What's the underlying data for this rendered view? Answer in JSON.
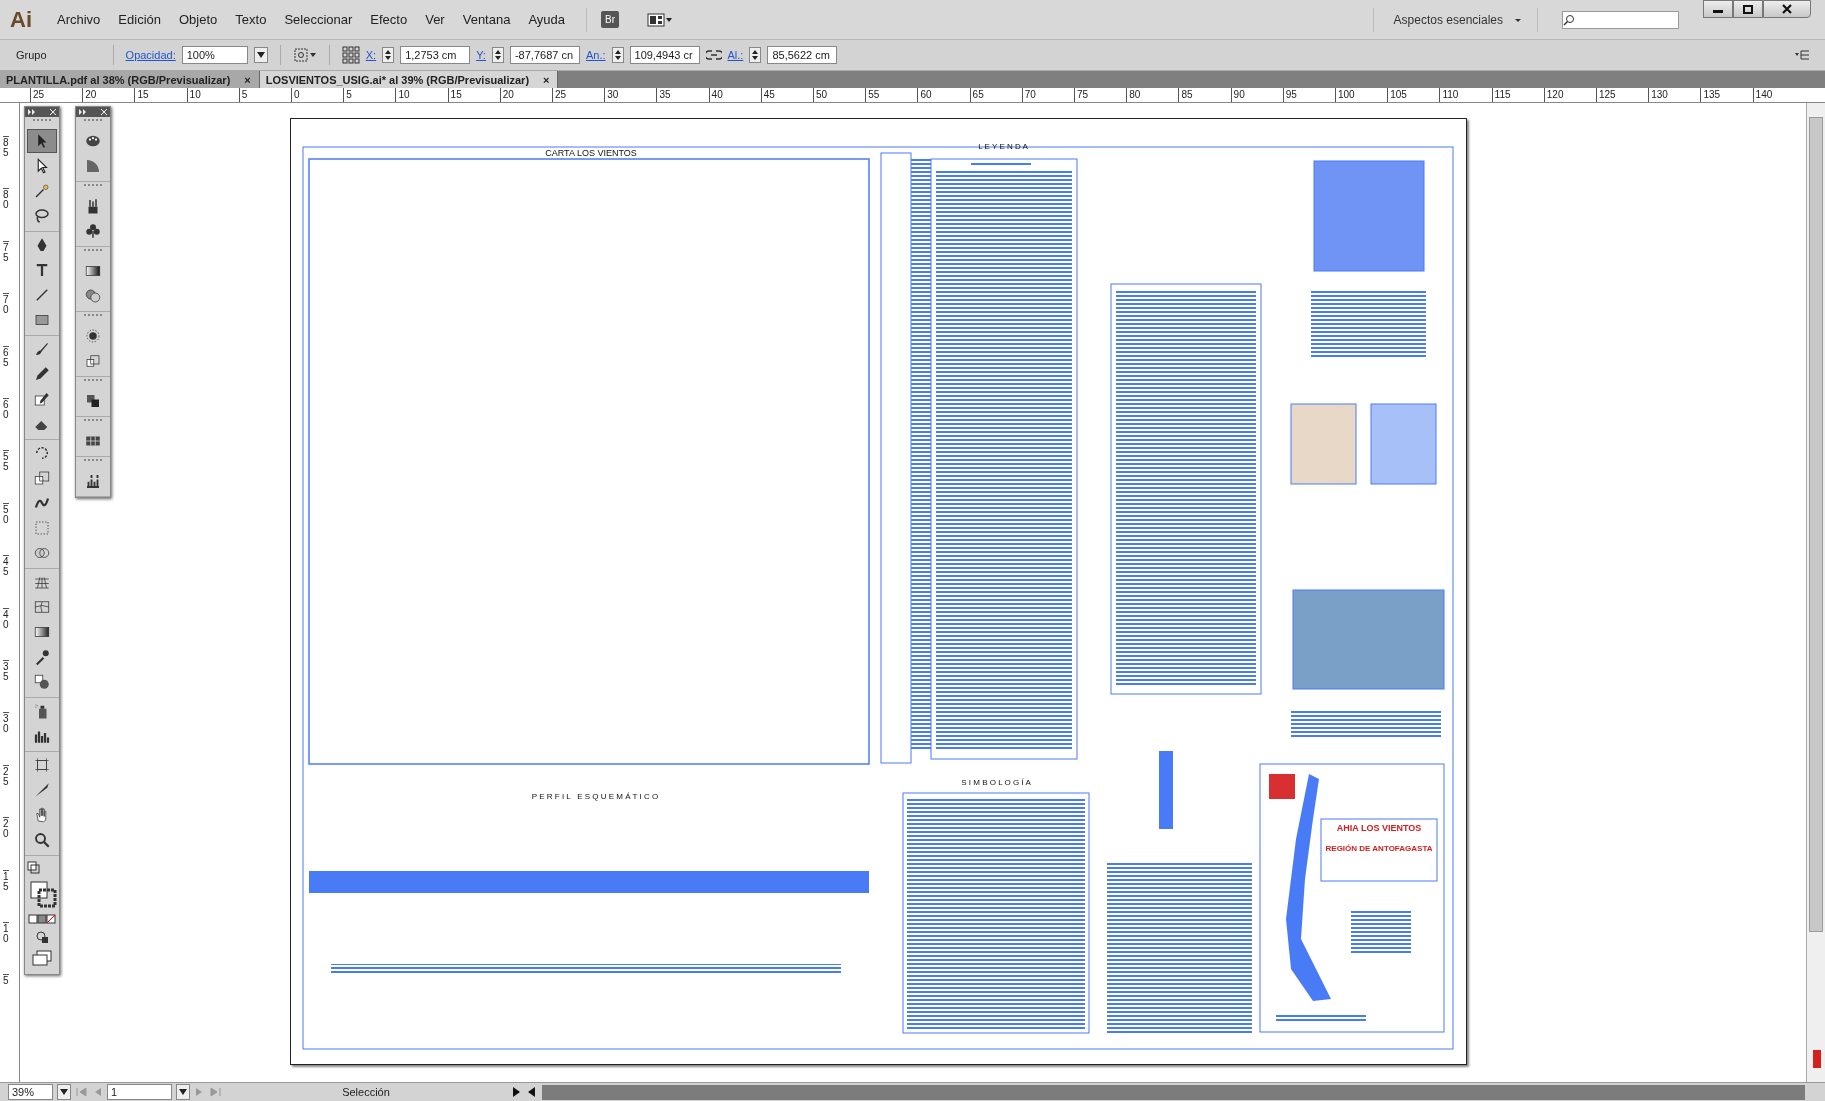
{
  "app_logo": "Ai",
  "menu": [
    "Archivo",
    "Edición",
    "Objeto",
    "Texto",
    "Seleccionar",
    "Efecto",
    "Ver",
    "Ventana",
    "Ayuda"
  ],
  "bridge_button": "Br",
  "workspace": "Aspectos esenciales",
  "control_bar": {
    "selection": "Grupo",
    "opacity_label": "Opacidad:",
    "opacity": "100%",
    "x_label": "X:",
    "x": "1,2753 cm",
    "y_label": "Y:",
    "y": "-87,7687 cn",
    "w_label": "An.:",
    "w": "109,4943 cr",
    "h_label": "Al.:",
    "h": "85,5622 cm"
  },
  "tabs": [
    {
      "label": "PLANTILLA.pdf al 38% (RGB/Previsualizar)",
      "close": "×",
      "selected": false
    },
    {
      "label": "LOSVIENTOS_USIG.ai* al 39% (RGB/Previsualizar)",
      "close": "×",
      "selected": true
    }
  ],
  "h_ruler": [
    "25",
    "20",
    "15",
    "10",
    "5",
    "0",
    "5",
    "10",
    "15",
    "20",
    "25",
    "30",
    "35",
    "40",
    "45",
    "50",
    "55",
    "60",
    "65",
    "70",
    "75",
    "80",
    "85",
    "90",
    "95",
    "100",
    "105",
    "110",
    "115",
    "120",
    "125",
    "130",
    "135",
    "140"
  ],
  "v_ruler": [
    "85",
    "80",
    "75",
    "70",
    "65",
    "60",
    "55",
    "50",
    "45",
    "40",
    "35",
    "30",
    "25",
    "20",
    "15",
    "10",
    "5"
  ],
  "tools": [
    {
      "selected": true
    },
    {
      "selected": false
    },
    {
      "selected": false
    },
    {
      "selected": false
    },
    {
      "selected": false
    },
    {
      "selected": false
    },
    {
      "selected": false
    },
    {
      "selected": false
    },
    {
      "selected": false
    },
    {
      "selected": false
    },
    {
      "selected": false
    },
    {
      "selected": false
    },
    {
      "selected": false
    },
    {
      "selected": false
    },
    {
      "selected": false
    },
    {
      "selected": false
    },
    {
      "selected": false
    },
    {
      "selected": false
    },
    {
      "selected": false
    },
    {
      "selected": false
    },
    {
      "selected": false
    },
    {
      "selected": false
    },
    {
      "selected": false
    },
    {
      "selected": false
    },
    {
      "selected": false
    },
    {
      "selected": false
    },
    {
      "selected": false
    },
    {
      "selected": false
    }
  ],
  "artboard": {
    "map_title": "CARTA LOS VIENTOS",
    "legend_title": "L E Y E N D A",
    "profile_title": "P E R F I L   E S Q U E M Á T I C O",
    "symbology_title": "S I M B O L O G Í A",
    "sheet_title": "AHIA LOS VIENTOS",
    "region": "REGIÓN DE ANTOFAGASTA"
  },
  "status_bar": {
    "zoom": "39%",
    "page": "1",
    "mode": "Selección"
  }
}
